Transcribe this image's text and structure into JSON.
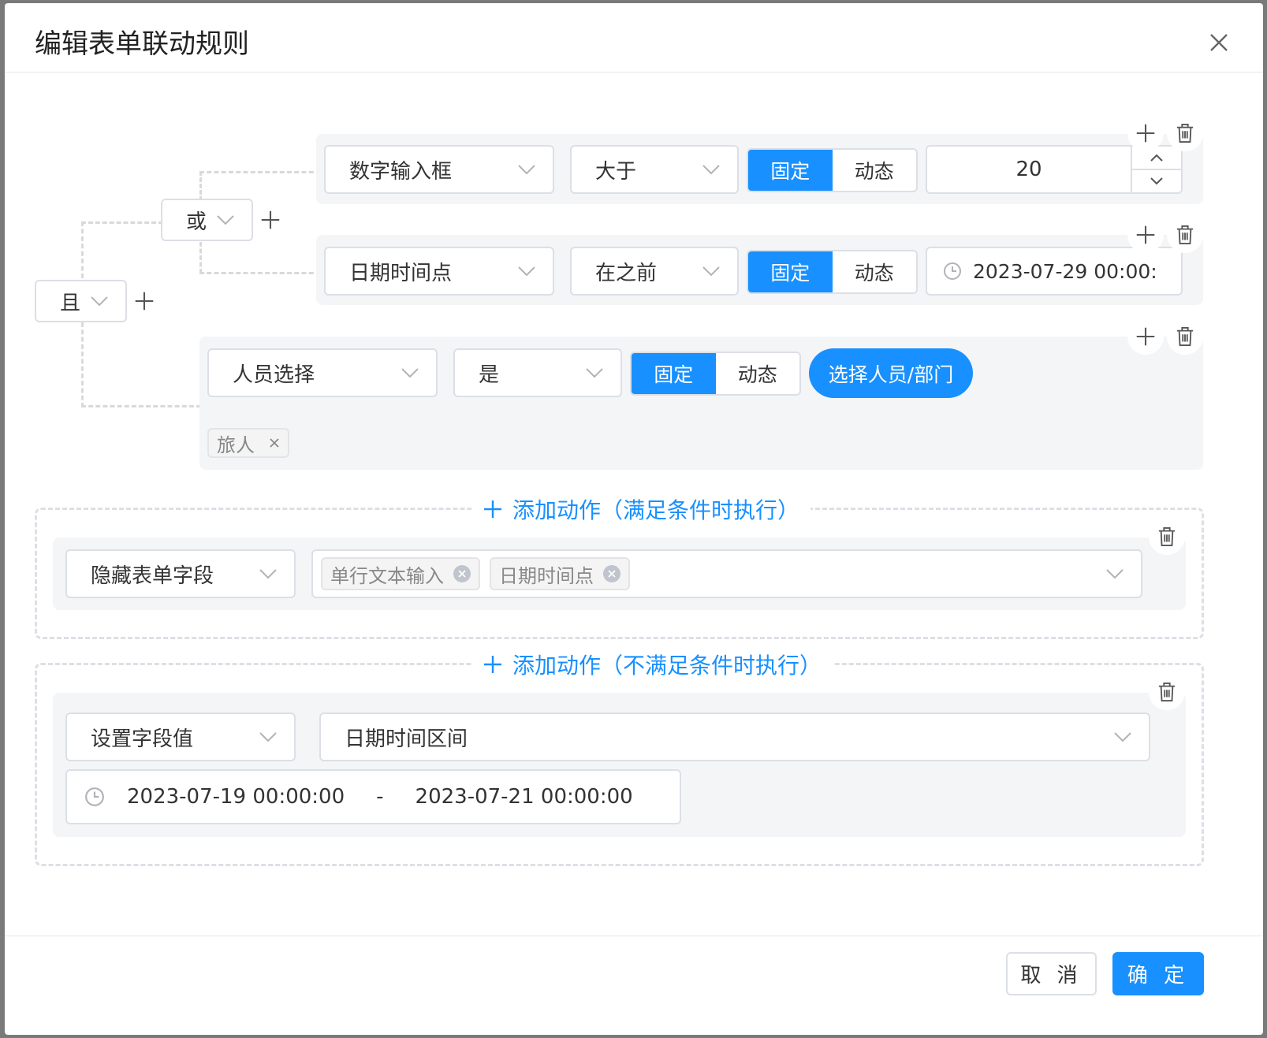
{
  "dialog": {
    "title": "编辑表单联动规则",
    "icons": {
      "close": "close-icon",
      "add": "plus-icon",
      "delete": "trash-icon",
      "dropdown": "chevron-down-icon",
      "clock": "clock-icon"
    }
  },
  "colors": {
    "primary": "#1890ff",
    "condition_bg": "#f4f5f7",
    "border": "#dcdfe6"
  },
  "logic": {
    "root_operator": "且",
    "group_operator": "或"
  },
  "conditions": [
    {
      "field": "数字输入框",
      "operator": "大于",
      "mode_fixed": "固定",
      "mode_dynamic": "动态",
      "selected_mode": "固定",
      "value": "20"
    },
    {
      "field": "日期时间点",
      "operator": "在之前",
      "mode_fixed": "固定",
      "mode_dynamic": "动态",
      "selected_mode": "固定",
      "value": "2023-07-29 00:00:"
    },
    {
      "field": "人员选择",
      "operator": "是",
      "mode_fixed": "固定",
      "mode_dynamic": "动态",
      "selected_mode": "固定",
      "select_button": "选择人员/部门",
      "tags": [
        "旅人"
      ]
    }
  ],
  "actions_match": {
    "add_label": "添加动作（满足条件时执行）",
    "action_type": "隐藏表单字段",
    "fields": [
      "单行文本输入",
      "日期时间点"
    ]
  },
  "actions_nomatch": {
    "add_label": "添加动作（不满足条件时执行）",
    "action_type": "设置字段值",
    "field": "日期时间区间",
    "range_start": "2023-07-19 00:00:00",
    "range_separator": "-",
    "range_end": "2023-07-21 00:00:00"
  },
  "footer": {
    "cancel": "取 消",
    "confirm": "确 定"
  }
}
